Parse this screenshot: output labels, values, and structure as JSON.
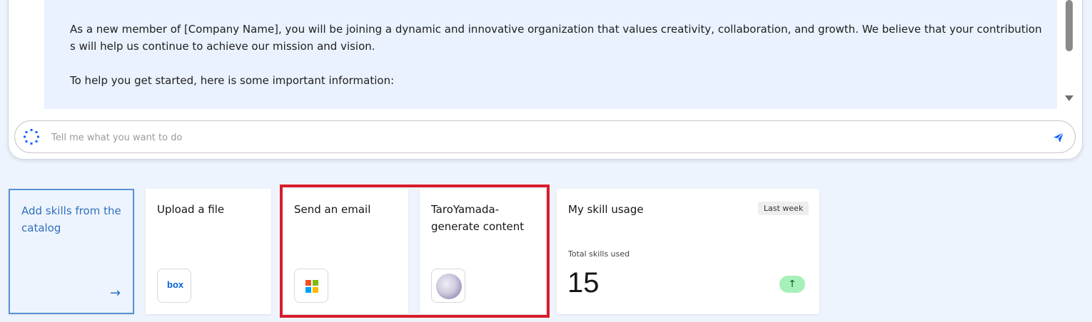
{
  "chat": {
    "message_paragraph_1": "As a new member of [Company Name], you will be joining a dynamic and innovative organization that values creativity, collaboration, and growth. We believe that your contributions will help us continue to achieve our mission and vision.",
    "message_paragraph_2": "To help you get started, here is some important information:",
    "input_placeholder": "Tell me what you want to do",
    "input_value": ""
  },
  "cards": {
    "add_skills": {
      "label": "Add skills from the catalog",
      "arrow": "→"
    },
    "upload_file": {
      "label": "Upload a file",
      "icon": "box-logo-icon",
      "logo_text": "box"
    },
    "send_email": {
      "label": "Send an email",
      "icon": "microsoft-logo-icon"
    },
    "generate_content": {
      "label": "TaroYamada-generate content",
      "icon": "avatar-icon"
    }
  },
  "usage": {
    "title": "My skill usage",
    "period": "Last week",
    "subtitle": "Total skills used",
    "count": "15",
    "trend_icon": "↑"
  },
  "colors": {
    "highlight": "#d91c2b",
    "accent": "#2f6fbf",
    "trend_bg": "#a7f0ba"
  }
}
